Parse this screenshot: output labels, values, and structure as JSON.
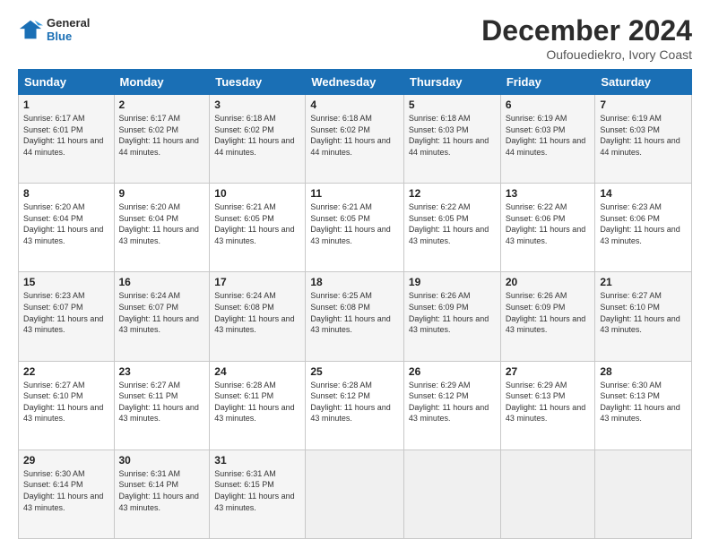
{
  "logo": {
    "line1": "General",
    "line2": "Blue"
  },
  "title": "December 2024",
  "location": "Oufouediekro, Ivory Coast",
  "days_of_week": [
    "Sunday",
    "Monday",
    "Tuesday",
    "Wednesday",
    "Thursday",
    "Friday",
    "Saturday"
  ],
  "weeks": [
    [
      {
        "day": "1",
        "sunrise": "6:17 AM",
        "sunset": "6:01 PM",
        "daylight": "11 hours and 44 minutes."
      },
      {
        "day": "2",
        "sunrise": "6:17 AM",
        "sunset": "6:02 PM",
        "daylight": "11 hours and 44 minutes."
      },
      {
        "day": "3",
        "sunrise": "6:18 AM",
        "sunset": "6:02 PM",
        "daylight": "11 hours and 44 minutes."
      },
      {
        "day": "4",
        "sunrise": "6:18 AM",
        "sunset": "6:02 PM",
        "daylight": "11 hours and 44 minutes."
      },
      {
        "day": "5",
        "sunrise": "6:18 AM",
        "sunset": "6:03 PM",
        "daylight": "11 hours and 44 minutes."
      },
      {
        "day": "6",
        "sunrise": "6:19 AM",
        "sunset": "6:03 PM",
        "daylight": "11 hours and 44 minutes."
      },
      {
        "day": "7",
        "sunrise": "6:19 AM",
        "sunset": "6:03 PM",
        "daylight": "11 hours and 44 minutes."
      }
    ],
    [
      {
        "day": "8",
        "sunrise": "6:20 AM",
        "sunset": "6:04 PM",
        "daylight": "11 hours and 43 minutes."
      },
      {
        "day": "9",
        "sunrise": "6:20 AM",
        "sunset": "6:04 PM",
        "daylight": "11 hours and 43 minutes."
      },
      {
        "day": "10",
        "sunrise": "6:21 AM",
        "sunset": "6:05 PM",
        "daylight": "11 hours and 43 minutes."
      },
      {
        "day": "11",
        "sunrise": "6:21 AM",
        "sunset": "6:05 PM",
        "daylight": "11 hours and 43 minutes."
      },
      {
        "day": "12",
        "sunrise": "6:22 AM",
        "sunset": "6:05 PM",
        "daylight": "11 hours and 43 minutes."
      },
      {
        "day": "13",
        "sunrise": "6:22 AM",
        "sunset": "6:06 PM",
        "daylight": "11 hours and 43 minutes."
      },
      {
        "day": "14",
        "sunrise": "6:23 AM",
        "sunset": "6:06 PM",
        "daylight": "11 hours and 43 minutes."
      }
    ],
    [
      {
        "day": "15",
        "sunrise": "6:23 AM",
        "sunset": "6:07 PM",
        "daylight": "11 hours and 43 minutes."
      },
      {
        "day": "16",
        "sunrise": "6:24 AM",
        "sunset": "6:07 PM",
        "daylight": "11 hours and 43 minutes."
      },
      {
        "day": "17",
        "sunrise": "6:24 AM",
        "sunset": "6:08 PM",
        "daylight": "11 hours and 43 minutes."
      },
      {
        "day": "18",
        "sunrise": "6:25 AM",
        "sunset": "6:08 PM",
        "daylight": "11 hours and 43 minutes."
      },
      {
        "day": "19",
        "sunrise": "6:26 AM",
        "sunset": "6:09 PM",
        "daylight": "11 hours and 43 minutes."
      },
      {
        "day": "20",
        "sunrise": "6:26 AM",
        "sunset": "6:09 PM",
        "daylight": "11 hours and 43 minutes."
      },
      {
        "day": "21",
        "sunrise": "6:27 AM",
        "sunset": "6:10 PM",
        "daylight": "11 hours and 43 minutes."
      }
    ],
    [
      {
        "day": "22",
        "sunrise": "6:27 AM",
        "sunset": "6:10 PM",
        "daylight": "11 hours and 43 minutes."
      },
      {
        "day": "23",
        "sunrise": "6:27 AM",
        "sunset": "6:11 PM",
        "daylight": "11 hours and 43 minutes."
      },
      {
        "day": "24",
        "sunrise": "6:28 AM",
        "sunset": "6:11 PM",
        "daylight": "11 hours and 43 minutes."
      },
      {
        "day": "25",
        "sunrise": "6:28 AM",
        "sunset": "6:12 PM",
        "daylight": "11 hours and 43 minutes."
      },
      {
        "day": "26",
        "sunrise": "6:29 AM",
        "sunset": "6:12 PM",
        "daylight": "11 hours and 43 minutes."
      },
      {
        "day": "27",
        "sunrise": "6:29 AM",
        "sunset": "6:13 PM",
        "daylight": "11 hours and 43 minutes."
      },
      {
        "day": "28",
        "sunrise": "6:30 AM",
        "sunset": "6:13 PM",
        "daylight": "11 hours and 43 minutes."
      }
    ],
    [
      {
        "day": "29",
        "sunrise": "6:30 AM",
        "sunset": "6:14 PM",
        "daylight": "11 hours and 43 minutes."
      },
      {
        "day": "30",
        "sunrise": "6:31 AM",
        "sunset": "6:14 PM",
        "daylight": "11 hours and 43 minutes."
      },
      {
        "day": "31",
        "sunrise": "6:31 AM",
        "sunset": "6:15 PM",
        "daylight": "11 hours and 43 minutes."
      },
      null,
      null,
      null,
      null
    ]
  ]
}
